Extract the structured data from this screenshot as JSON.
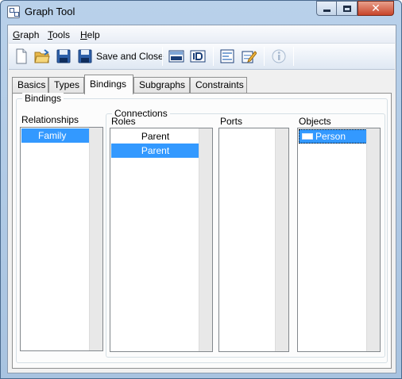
{
  "window": {
    "title": "Graph Tool"
  },
  "menu": [
    {
      "mnemonic": "G",
      "rest": "raph"
    },
    {
      "mnemonic": "T",
      "rest": "ools"
    },
    {
      "mnemonic": "H",
      "rest": "elp"
    }
  ],
  "toolbar": {
    "save_close_label": "Save and Close",
    "icons": [
      "new-file-icon",
      "open-folder-icon",
      "save-icon",
      "save-and-close-icon",
      "merl-icon",
      "id-icon",
      "form-icon",
      "edit-icon",
      "info-icon"
    ]
  },
  "tabs": [
    "Basics",
    "Types",
    "Bindings",
    "Subgraphs",
    "Constraints"
  ],
  "active_tab": "Bindings",
  "bindings": {
    "group_label": "Bindings",
    "relationships": {
      "label": "Relationships",
      "items": [
        "Family"
      ]
    },
    "connections": {
      "group_label": "Connections",
      "roles": {
        "label": "Roles",
        "items": [
          "Parent",
          "Parent"
        ]
      },
      "ports": {
        "label": "Ports",
        "items": []
      }
    },
    "objects": {
      "label": "Objects",
      "items": [
        "Person"
      ]
    }
  },
  "colors": {
    "selection": "#3399ff",
    "titlebar": "#b9d1ea",
    "close_button": "#c8452b"
  }
}
